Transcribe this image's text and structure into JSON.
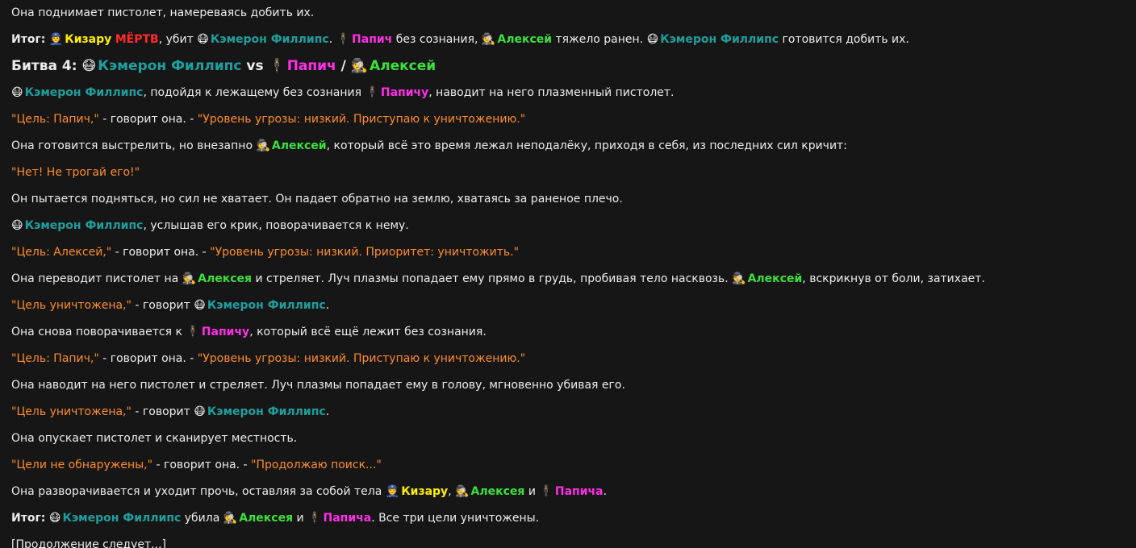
{
  "colors": {
    "background": "#161616",
    "text": "#ececec",
    "quote": "#ff8c2a",
    "cameron": "#1f9e9e",
    "papich": "#ff2ee6",
    "alexey": "#3be03b",
    "kizaru": "#ffee00",
    "dead": "#ff2a2a"
  },
  "icons": {
    "cameron": "robot-mask-icon",
    "papich": "man-in-suit-icon",
    "alexey": "detective-icon",
    "kizaru": "police-officer-icon"
  },
  "lines": [
    "Она поднимает пистолет, намереваясь добить их.",
    {
      "label": "Итог:",
      "kizaru": "Кизару",
      "dead": "МЁРТВ",
      "t1": ", убит",
      "cameron": "Кэмерон Филлипс",
      "t2": ".",
      "papich": "Папич",
      "t3": "без сознания,",
      "alexey": "Алексей",
      "t4": "тяжело ранен.",
      "cameron2": "Кэмерон Филлипс",
      "t5": "готовится добить их."
    },
    {
      "battle": "Битва 4:",
      "cameron": "Кэмерон Филлипс",
      "vs": "vs",
      "papich": "Папич",
      "slash": "/",
      "alexey": "Алексей"
    },
    {
      "cameron": "Кэмерон Филлипс",
      "t1": ", подойдя к лежащему без сознания",
      "papich": "Папичу",
      "t2": ", наводит на него плазменный пистолет."
    },
    {
      "q1": "\"Цель: Папич,\"",
      "t1": " - говорит она. - ",
      "q2": "\"Уровень угрозы: низкий. Приступаю к уничтожению.\""
    },
    {
      "t1": "Она готовится выстрелить, но внезапно",
      "alexey": "Алексей",
      "t2": ", который всё это время лежал неподалёку, приходя в себя, из последних сил кричит:"
    },
    "\"Нет! Не трогай его!\"",
    "Он пытается подняться, но сил не хватает. Он падает обратно на землю, хватаясь за раненое плечо.",
    {
      "cameron": "Кэмерон Филлипс",
      "t1": ", услышав его крик, поворачивается к нему."
    },
    {
      "q1": "\"Цель: Алексей,\"",
      "t1": " - говорит она. - ",
      "q2": "\"Уровень угрозы: низкий. Приоритет: уничтожить.\""
    },
    {
      "t1": "Она переводит пистолет на",
      "alexey": "Алексея",
      "t2": "и стреляет. Луч плазмы попадает ему прямо в грудь, пробивая тело насквозь.",
      "alexey2": "Алексей",
      "t3": ", вскрикнув от боли, затихает."
    },
    {
      "q1": "\"Цель уничтожена,\"",
      "t1": " - говорит",
      "cameron": "Кэмерон Филлипс",
      "t2": "."
    },
    {
      "t1": "Она снова поворачивается к",
      "papich": "Папичу",
      "t2": ", который всё ещё лежит без сознания."
    },
    {
      "q1": "\"Цель: Папич,\"",
      "t1": " - говорит она. - ",
      "q2": "\"Уровень угрозы: низкий. Приступаю к уничтожению.\""
    },
    "Она наводит на него пистолет и стреляет. Луч плазмы попадает ему в голову, мгновенно убивая его.",
    {
      "q1": "\"Цель уничтожена,\"",
      "t1": " - говорит",
      "cameron": "Кэмерон Филлипс",
      "t2": "."
    },
    "Она опускает пистолет и сканирует местность.",
    {
      "q1": "\"Цели не обнаружены,\"",
      "t1": " - говорит она. - ",
      "q2": "\"Продолжаю поиск...\""
    },
    {
      "t1": "Она разворачивается и уходит прочь, оставляя за собой тела",
      "kizaru": "Кизару",
      "t2": ",",
      "alexey": "Алексея",
      "t3": "и",
      "papich": "Папича",
      "t4": "."
    },
    {
      "label": "Итог:",
      "cameron": "Кэмерон Филлипс",
      "t1": "убила",
      "alexey": "Алексея",
      "t2": "и",
      "papich": "Папича",
      "t3": ". Все три цели уничтожены."
    },
    "[Продолжение следует...]"
  ]
}
